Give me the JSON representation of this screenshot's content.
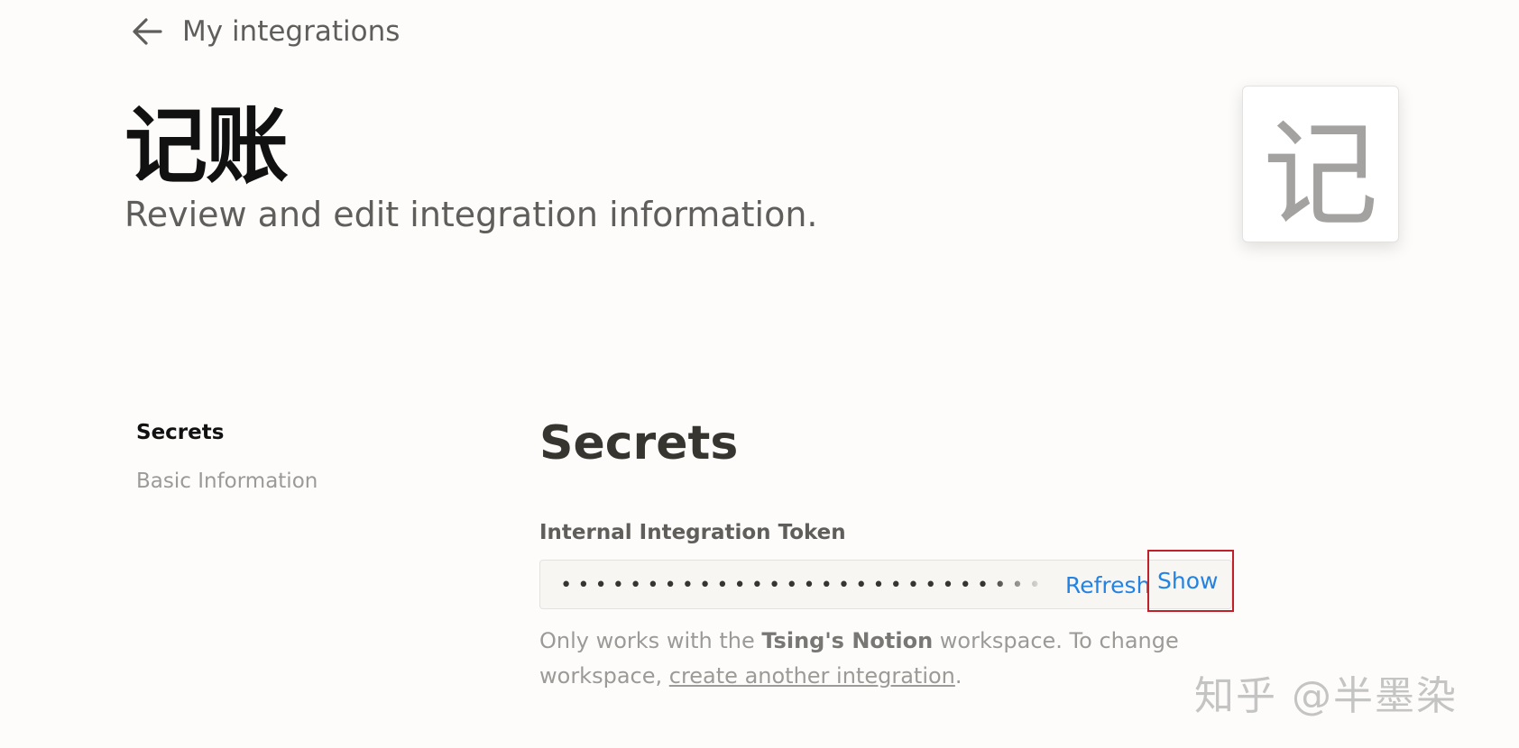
{
  "header": {
    "back_label": "My integrations",
    "title": "记账",
    "subtitle": "Review and edit integration information.",
    "icon_glyph": "记"
  },
  "sidebar": {
    "items": [
      {
        "label": "Secrets",
        "active": true
      },
      {
        "label": "Basic Information",
        "active": false
      }
    ]
  },
  "secrets": {
    "title": "Secrets",
    "token_label": "Internal Integration Token",
    "token_masked": "••••••••••••••••••••••••••••••••••••••••••••••••••",
    "refresh_label": "Refresh",
    "show_label": "Show",
    "help_prefix": "Only works with the ",
    "help_workspace": "Tsing's Notion",
    "help_middle": " workspace. To change workspace, ",
    "help_link": "create another integration",
    "help_suffix": "."
  },
  "watermark": "知乎 @半墨染",
  "colors": {
    "accent_link": "#2383e2",
    "highlight_box": "#c0202a"
  }
}
